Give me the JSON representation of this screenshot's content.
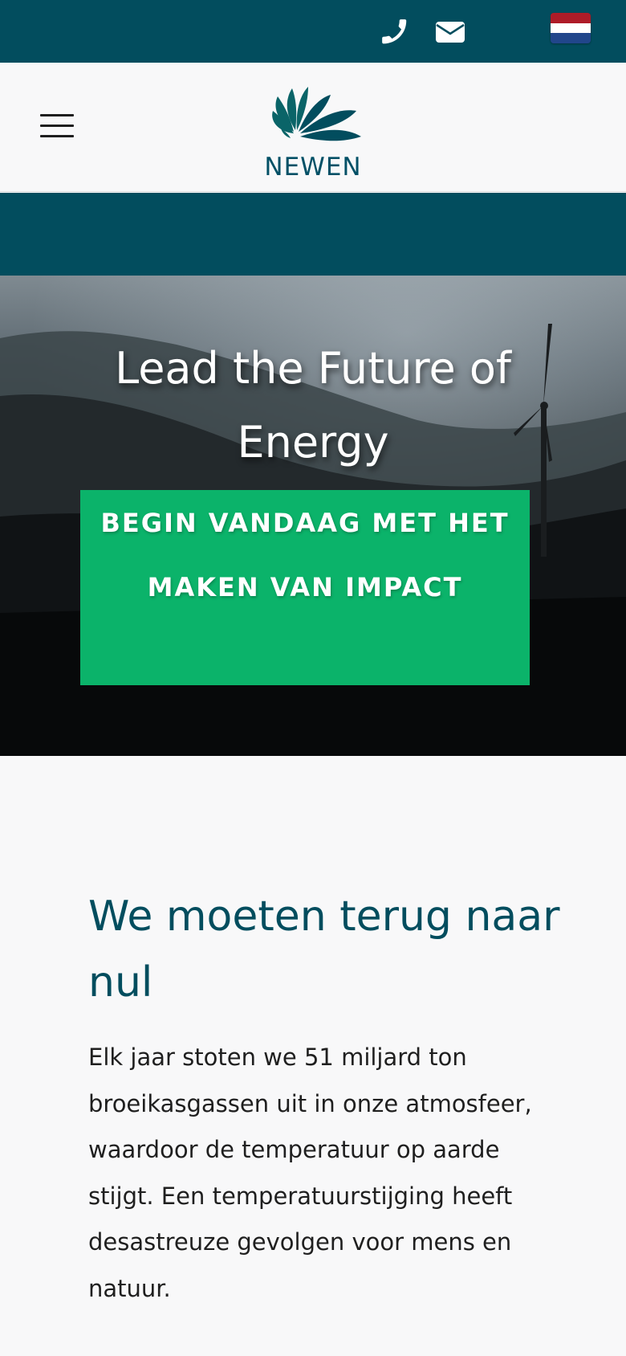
{
  "topbar": {
    "phone_icon": "phone-icon",
    "email_icon": "envelope-icon",
    "language_flag": "netherlands-flag-icon",
    "flag_colors": [
      "#ae1c28",
      "#ffffff",
      "#21468b"
    ]
  },
  "header": {
    "menu_icon": "hamburger-menu-icon",
    "logo_text": "NEWEN"
  },
  "hero": {
    "title": "Lead the Future of Energy",
    "cta_label": "BEGIN VANDAAG MET HET MAKEN VAN IMPACT"
  },
  "content": {
    "heading": "We moeten terug naar nul",
    "body": "Elk jaar stoten we 51 miljard ton broeikasgassen uit in onze atmosfeer, waardoor de temperatuur op aarde stijgt. Een temperatuurstijging heeft desastreuze gevolgen voor mens en natuur."
  },
  "colors": {
    "brand_teal": "#024d5e",
    "cta_green": "#0bb36a",
    "background": "#f8f8f9"
  }
}
